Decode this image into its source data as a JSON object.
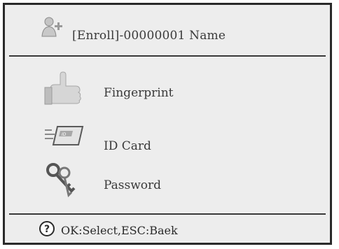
{
  "header": {
    "title": "[Enroll]-00000001 Name",
    "icon": "user-enroll-icon"
  },
  "menu": {
    "items": [
      {
        "label": "Fingerprint",
        "icon": "fingerprint-hand-icon"
      },
      {
        "label": "ID Card",
        "icon": "id-card-icon"
      },
      {
        "label": "Password",
        "icon": "password-keys-icon"
      }
    ]
  },
  "footer": {
    "hint": "OK:Select,ESC:Baek",
    "icon": "help-icon"
  },
  "colors": {
    "background": "#ededed",
    "border": "#2a2a2a",
    "text": "#3a3a3a",
    "icon_gray": "#b8b8b8"
  }
}
